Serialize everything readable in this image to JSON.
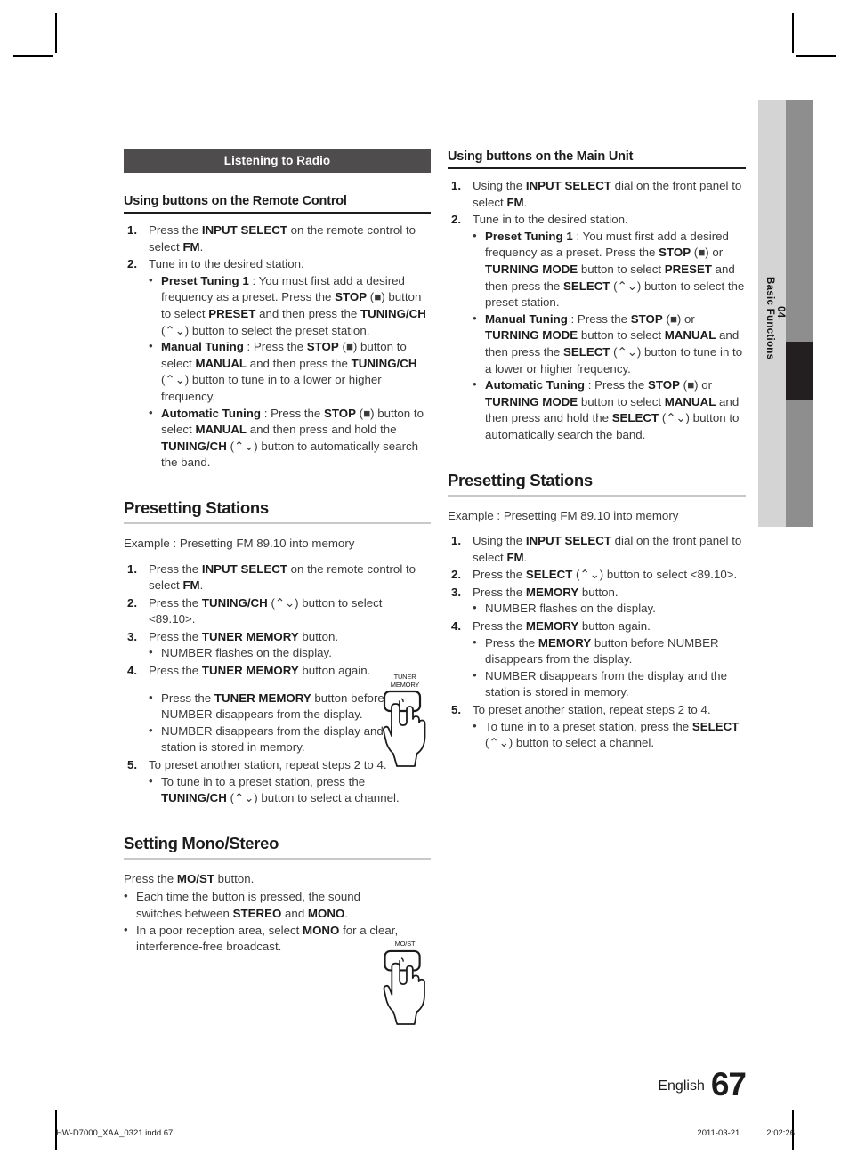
{
  "side_tab": {
    "chapter_number": "04",
    "chapter_title": "Basic Functions"
  },
  "banner": {
    "title": "Listening to Radio"
  },
  "left_column": {
    "head_remote": "Using buttons on the Remote Control",
    "step1_num": "1.",
    "step1_a": "Press the ",
    "step1_b": "INPUT SELECT",
    "step1_c": " on the remote control to select ",
    "step1_d": "FM",
    "step1_e": ".",
    "step2_num": "2.",
    "step2_text": "Tune in to the desired station.",
    "preset_label": "Preset Tuning 1",
    "preset_t1": " : You must first add a desired frequency as a preset. Press the ",
    "preset_b1": "STOP",
    "preset_t2": " (■) button to select ",
    "preset_b2": "PRESET",
    "preset_t3": " and then press the ",
    "preset_b3": "TUNING/CH",
    "preset_t4": " (⌃⌄) button to select the preset station.",
    "manual_label": "Manual Tuning",
    "manual_t1": " : Press the ",
    "manual_b1": "STOP",
    "manual_t2": " (■) button to select ",
    "manual_b2": "MANUAL",
    "manual_t3": " and then press the ",
    "manual_b3": "TUNING/CH",
    "manual_t4": " (⌃⌄) button to tune in to a lower or higher frequency.",
    "auto_label": "Automatic Tuning",
    "auto_t1": " : Press the ",
    "auto_b1": "STOP",
    "auto_t2": " (■) button to select ",
    "auto_b2": "MANUAL",
    "auto_t3": " and then press and hold the ",
    "auto_b3": "TUNING/CH",
    "auto_t4": " (⌃⌄) button to automatically search the band.",
    "presetting_head": "Presetting Stations",
    "presetting_example": "Example : Presetting FM 89.10 into memory",
    "p_step1_num": "1.",
    "p_step1_a": "Press the ",
    "p_step1_b": "INPUT SELECT",
    "p_step1_c": " on the remote control to select ",
    "p_step1_d": "FM",
    "p_step1_e": ".",
    "p_step2_num": "2.",
    "p_step2_a": "Press the ",
    "p_step2_b": "TUNING/CH",
    "p_step2_c": " (⌃⌄) button to select <89.10>.",
    "p_step3_num": "3.",
    "p_step3_a": "Press the ",
    "p_step3_b": "TUNER MEMORY",
    "p_step3_c": " button.",
    "p_step3_bullet": "NUMBER flashes on the display.",
    "p_step4_num": "4.",
    "p_step4_a": "Press the ",
    "p_step4_b": "TUNER MEMORY",
    "p_step4_c": " button again.",
    "p_step4_bullet1_a": "Press the ",
    "p_step4_bullet1_b": "TUNER MEMORY",
    "p_step4_bullet1_c": " button before NUMBER disappears from the display.",
    "p_step4_bullet2": "NUMBER disappears from the display and the station is stored in memory.",
    "p_step5_num": "5.",
    "p_step5_text": "To preset another station, repeat steps 2 to 4.",
    "p_step5_bullet_a": "To tune in to a preset station, press the ",
    "p_step5_bullet_b": "TUNING/CH",
    "p_step5_bullet_c": " (⌃⌄) button to select a channel.",
    "mono_head": "Setting Mono/Stereo",
    "mono_intro_a": "Press the ",
    "mono_intro_b": "MO/ST",
    "mono_intro_c": " button.",
    "mono_b1_a": "Each time the button is pressed, the sound switches between ",
    "mono_b1_b": "STEREO",
    "mono_b1_c": " and ",
    "mono_b1_d": "MONO",
    "mono_b1_e": ".",
    "mono_b2_a": "In a poor reception area, select ",
    "mono_b2_b": "MONO",
    "mono_b2_c": " for a clear, interference-free broadcast."
  },
  "right_column": {
    "head_main_unit": "Using buttons on the Main Unit",
    "step1_num": "1.",
    "step1_a": "Using the ",
    "step1_b": "INPUT SELECT",
    "step1_c": " dial on the front panel to select ",
    "step1_d": "FM",
    "step1_e": ".",
    "step2_num": "2.",
    "step2_text": "Tune in to the desired station.",
    "preset_label": "Preset Tuning 1",
    "preset_t1": " : You must first add a desired frequency as a preset. Press the ",
    "preset_b1": "STOP",
    "preset_t2": " (■) or ",
    "preset_b2": "TURNING MODE",
    "preset_t3": " button to select ",
    "preset_b3": "PRESET",
    "preset_t4": " and then press the ",
    "preset_b4": "SELECT",
    "preset_t5": " (⌃⌄) button to select the preset station.",
    "manual_label": "Manual Tuning",
    "manual_t1": " : Press the ",
    "manual_b1": "STOP",
    "manual_t2": " (■) or ",
    "manual_b2": "TURNING MODE",
    "manual_t3": " button to select ",
    "manual_b3": "MANUAL",
    "manual_t4": " and then press the ",
    "manual_b4": "SELECT",
    "manual_t5": " (⌃⌄) button to tune in to a lower or higher frequency.",
    "auto_label": "Automatic Tuning",
    "auto_t1": " : Press the ",
    "auto_b1": "STOP",
    "auto_t2": " (■) or ",
    "auto_b2": "TURNING MODE",
    "auto_t3": " button to select ",
    "auto_b3": "MANUAL",
    "auto_t4": " and then press and hold the ",
    "auto_b4": "SELECT",
    "auto_t5": " (⌃⌄) button to automatically search the band.",
    "presetting_head": "Presetting Stations",
    "presetting_example": "Example : Presetting FM 89.10 into memory",
    "p_step1_num": "1.",
    "p_step1_a": "Using the ",
    "p_step1_b": "INPUT SELECT",
    "p_step1_c": " dial on the front panel to select ",
    "p_step1_d": "FM",
    "p_step1_e": ".",
    "p_step2_num": "2.",
    "p_step2_a": "Press the ",
    "p_step2_b": "SELECT",
    "p_step2_c": " (⌃⌄) button to select <89.10>.",
    "p_step3_num": "3.",
    "p_step3_a": "Press the ",
    "p_step3_b": "MEMORY",
    "p_step3_c": " button.",
    "p_step3_bullet": "NUMBER flashes on the display.",
    "p_step4_num": "4.",
    "p_step4_a": "Press the ",
    "p_step4_b": "MEMORY",
    "p_step4_c": " button again.",
    "p_step4_bullet1_a": "Press the ",
    "p_step4_bullet1_b": "MEMORY",
    "p_step4_bullet1_c": " button before NUMBER disappears from the display.",
    "p_step4_bullet2": "NUMBER disappears from the display and the station is stored in memory.",
    "p_step5_num": "5.",
    "p_step5_text": "To preset another station, repeat steps 2 to 4.",
    "p_step5_bullet_a": "To tune in to a preset station, press the ",
    "p_step5_bullet_b": "SELECT",
    "p_step5_bullet_c": " (⌃⌄) button to select a channel."
  },
  "illustrations": {
    "tuner_memory_line1": "TUNER",
    "tuner_memory_line2": "MEMORY",
    "most_label": "MO/ST"
  },
  "footer": {
    "language": "English",
    "page_number": "67",
    "imprint_file": "HW-D7000_XAA_0321.indd   67",
    "imprint_date": "2011-03-21",
    "imprint_time": "2:02:26"
  },
  "colors": {
    "banner_bg": "#4e4c4c",
    "tab_light": "#d4d4d4",
    "tab_dark": "#8e8e8e",
    "tab_marker": "#231f20",
    "body_text": "#3a3a3a",
    "heading_text": "#1c1c1c"
  }
}
